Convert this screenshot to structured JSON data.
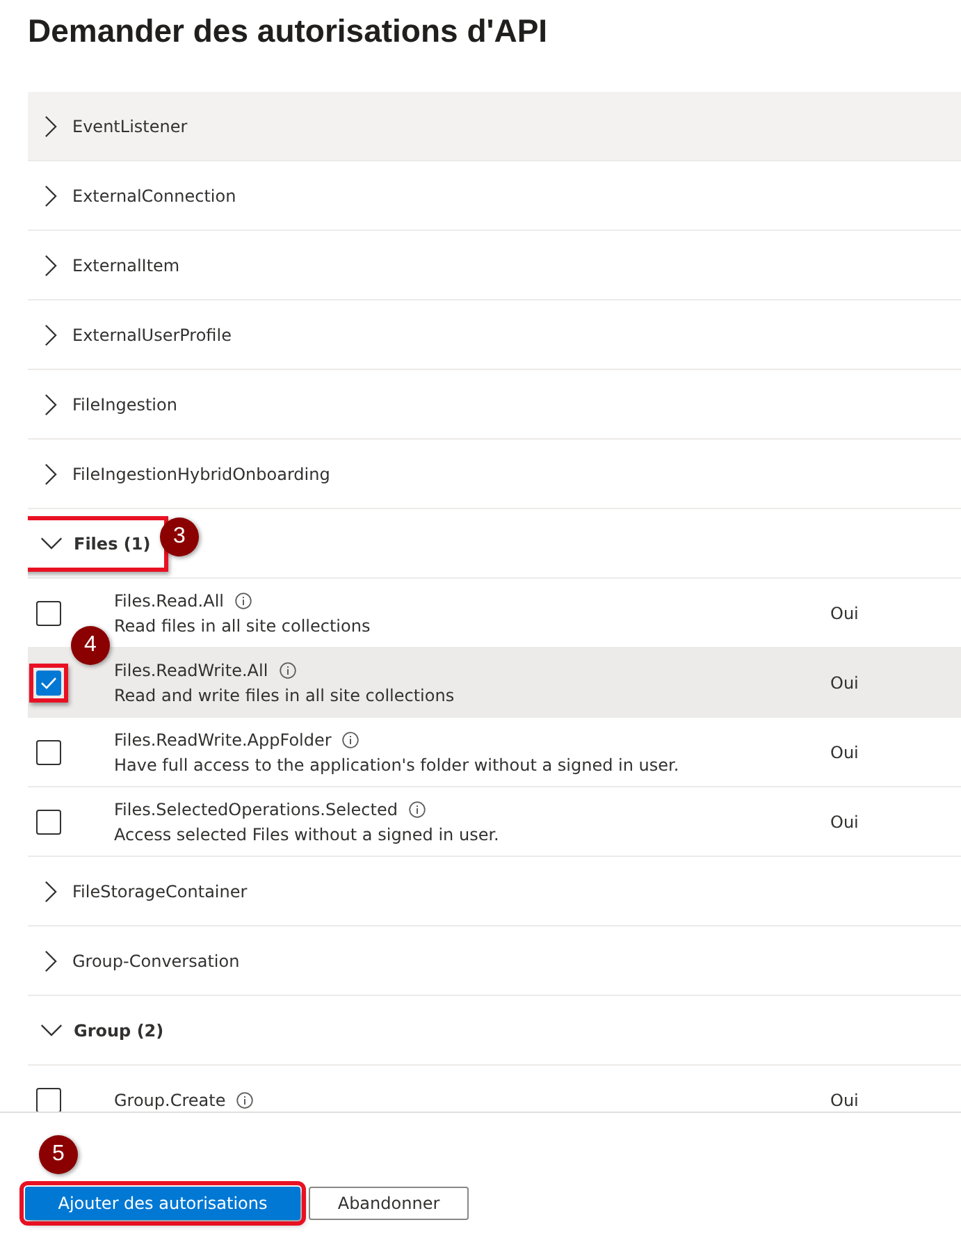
{
  "title": "Demander des autorisations d'API",
  "groups": [
    {
      "label": "EventListener",
      "expanded": false,
      "hover": true,
      "highlighted": false
    },
    {
      "label": "ExternalConnection",
      "expanded": false,
      "hover": false,
      "highlighted": false
    },
    {
      "label": "ExternalItem",
      "expanded": false,
      "hover": false,
      "highlighted": false
    },
    {
      "label": "ExternalUserProfile",
      "expanded": false,
      "hover": false,
      "highlighted": false
    },
    {
      "label": "FileIngestion",
      "expanded": false,
      "hover": false,
      "highlighted": false
    },
    {
      "label": "FileIngestionHybridOnboarding",
      "expanded": false,
      "hover": false,
      "highlighted": false
    },
    {
      "label": "Files (1)",
      "expanded": true,
      "hover": false,
      "highlighted": true,
      "badge": "3",
      "permissions": [
        {
          "name": "Files.Read.All",
          "description": "Read files in all site collections",
          "admin_consent": "Oui",
          "checked": false,
          "highlighted": false
        },
        {
          "name": "Files.ReadWrite.All",
          "description": "Read and write files in all site collections",
          "admin_consent": "Oui",
          "checked": true,
          "highlighted": true,
          "badge": "4"
        },
        {
          "name": "Files.ReadWrite.AppFolder",
          "description": "Have full access to the application's folder without a signed in user.",
          "admin_consent": "Oui",
          "checked": false,
          "highlighted": false
        },
        {
          "name": "Files.SelectedOperations.Selected",
          "description": "Access selected Files without a signed in user.",
          "admin_consent": "Oui",
          "checked": false,
          "highlighted": false
        }
      ]
    },
    {
      "label": "FileStorageContainer",
      "expanded": false,
      "hover": false,
      "highlighted": false
    },
    {
      "label": "Group-Conversation",
      "expanded": false,
      "hover": false,
      "highlighted": false
    },
    {
      "label": "Group (2)",
      "expanded": true,
      "hover": false,
      "highlighted": false,
      "permissions": [
        {
          "name": "Group.Create",
          "admin_consent": "Oui",
          "checked": false,
          "highlighted": false
        }
      ]
    }
  ],
  "footer": {
    "badge": "5",
    "buttons": [
      {
        "label": "Ajouter des autorisations",
        "kind": "primary",
        "highlighted": true
      },
      {
        "label": "Abandonner",
        "kind": "secondary",
        "highlighted": false
      }
    ]
  }
}
